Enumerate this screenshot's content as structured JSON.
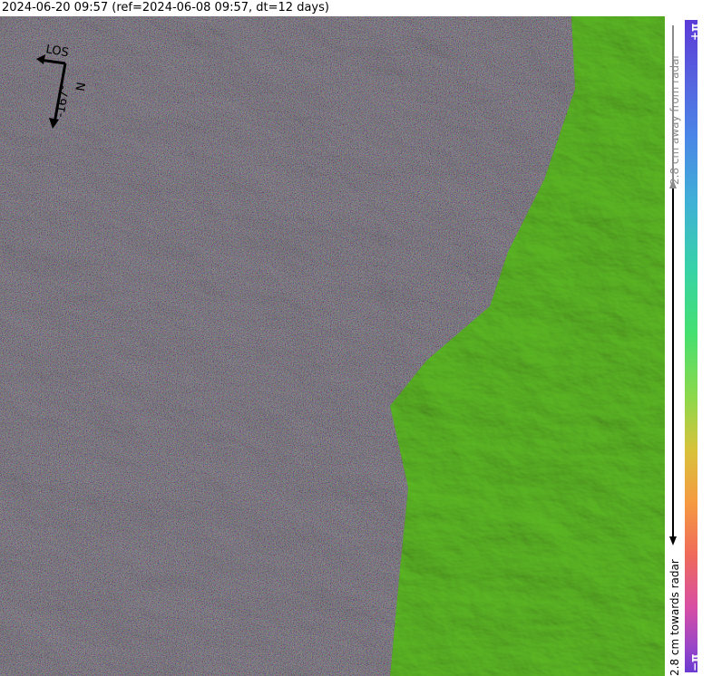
{
  "header": {
    "title": "2024-06-20 09:57 (ref=2024-06-08 09:57, dt=12 days)"
  },
  "compass": {
    "los_label": "LOS",
    "north_label": "N",
    "heading_label": "-167°"
  },
  "colorbar": {
    "top_label": "+π",
    "bottom_label": "−π",
    "away_label": "2.8 cm away from radar",
    "towards_label": "2.8 cm towards radar",
    "colors": [
      "#5b3ad8",
      "#4a86e6",
      "#3fb0d6",
      "#45e070",
      "#8ed84a",
      "#d8c23a",
      "#f59a42",
      "#d84ea4",
      "#6a3ad0"
    ]
  },
  "map": {
    "coherent_color": "#7fd03c",
    "decorrelated_colors": [
      "#3a3a3a",
      "#7a7a7a",
      "#b06ab0",
      "#c47a5a",
      "#5a9a7a",
      "#6a8ad0",
      "#a0a060"
    ]
  }
}
